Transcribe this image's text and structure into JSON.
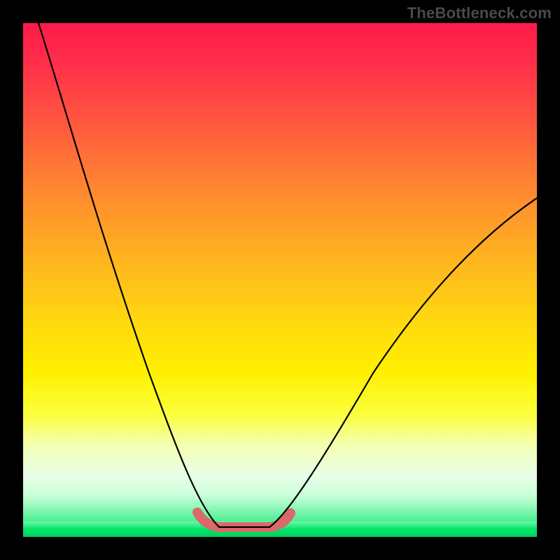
{
  "watermark": "TheBottleneck.com",
  "chart_data": {
    "type": "line",
    "title": "",
    "xlabel": "",
    "ylabel": "",
    "xlim": [
      0,
      100
    ],
    "ylim": [
      0,
      100
    ],
    "series": [
      {
        "name": "curve",
        "x": [
          3,
          6,
          10,
          14,
          18,
          22,
          26,
          30,
          33,
          35,
          37,
          40,
          44,
          47,
          50,
          55,
          62,
          72,
          85,
          100
        ],
        "values": [
          100,
          92,
          82,
          72,
          62,
          52,
          42,
          32,
          22,
          14,
          8,
          3,
          0,
          0,
          2,
          8,
          18,
          32,
          46,
          60
        ]
      }
    ],
    "highlight": {
      "name": "bottom-band",
      "x_range": [
        34,
        52
      ],
      "y": 0
    },
    "background": "rainbow-vertical-gradient"
  }
}
